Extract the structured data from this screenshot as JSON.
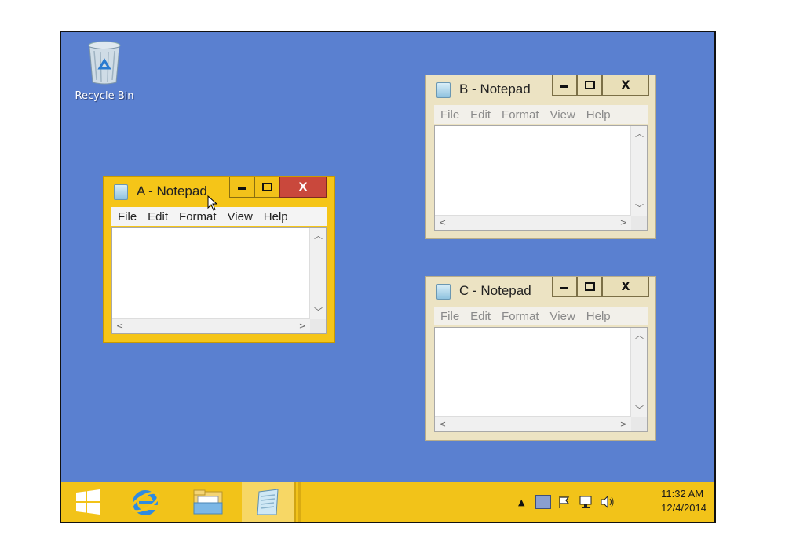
{
  "desktop": {
    "icons": [
      {
        "label": "Recycle Bin",
        "icon": "recycle-bin-icon"
      }
    ]
  },
  "windows": [
    {
      "title": "A - Notepad",
      "state": "active",
      "menu": [
        "File",
        "Edit",
        "Format",
        "View",
        "Help"
      ]
    },
    {
      "title": "B - Notepad",
      "state": "inactive",
      "menu": [
        "File",
        "Edit",
        "Format",
        "View",
        "Help"
      ]
    },
    {
      "title": "C - Notepad",
      "state": "inactive",
      "menu": [
        "File",
        "Edit",
        "Format",
        "View",
        "Help"
      ]
    }
  ],
  "window_controls": {
    "minimize": "minimize-icon",
    "maximize": "maximize-icon",
    "close": "X"
  },
  "taskbar": {
    "buttons": [
      "windows-start-icon",
      "internet-explorer-icon",
      "file-explorer-icon",
      "notepad-icon"
    ],
    "tray_icons": [
      "show-hidden-icons-chevron",
      "action-center-icon",
      "flag-icon",
      "network-icon",
      "speaker-icon"
    ],
    "clock": {
      "time": "11:32 AM",
      "date": "12/4/2014"
    }
  },
  "colors": {
    "desktop": "#5a80d0",
    "taskbar": "#f2c319",
    "active_frame": "#f5c518",
    "inactive_frame": "#ece3c3",
    "close_active": "#c9483c"
  }
}
